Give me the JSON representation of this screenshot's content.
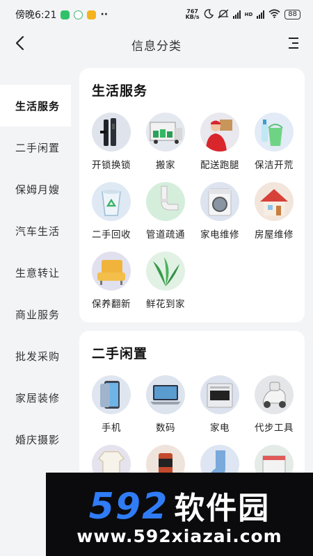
{
  "status_bar": {
    "time": "傍晚6:21",
    "dots": "··",
    "net_speed_value": "767",
    "net_speed_unit": "KB/s",
    "hd": "HD",
    "battery": "88"
  },
  "header": {
    "title": "信息分类",
    "back_icon": "chevron-left-icon",
    "menu_icon": "list-menu-icon"
  },
  "sidebar": {
    "items": [
      {
        "label": "生活服务",
        "active": true
      },
      {
        "label": "二手闲置",
        "active": false
      },
      {
        "label": "保姆月嫂",
        "active": false
      },
      {
        "label": "汽车生活",
        "active": false
      },
      {
        "label": "生意转让",
        "active": false
      },
      {
        "label": "商业服务",
        "active": false
      },
      {
        "label": "批发采购",
        "active": false
      },
      {
        "label": "家居装修",
        "active": false
      },
      {
        "label": "婚庆摄影",
        "active": false
      }
    ]
  },
  "sections": [
    {
      "title": "生活服务",
      "items": [
        {
          "label": "开锁换锁",
          "icon": "door-lock-icon"
        },
        {
          "label": "搬家",
          "icon": "moving-truck-icon"
        },
        {
          "label": "配送跑腿",
          "icon": "delivery-person-icon"
        },
        {
          "label": "保洁开荒",
          "icon": "cleaning-bucket-icon"
        },
        {
          "label": "二手回收",
          "icon": "recycle-bin-icon"
        },
        {
          "label": "管道疏通",
          "icon": "pipe-icon"
        },
        {
          "label": "家电维修",
          "icon": "washing-machine-icon"
        },
        {
          "label": "房屋维修",
          "icon": "house-icon"
        },
        {
          "label": "保养翻新",
          "icon": "sofa-icon"
        },
        {
          "label": "鲜花到家",
          "icon": "plant-icon"
        }
      ]
    },
    {
      "title": "二手闲置",
      "items": [
        {
          "label": "手机",
          "icon": "phone-icon"
        },
        {
          "label": "数码",
          "icon": "laptop-icon"
        },
        {
          "label": "家电",
          "icon": "appliance-icon"
        },
        {
          "label": "代步工具",
          "icon": "scooter-icon"
        }
      ]
    }
  ],
  "watermark": {
    "number": "592",
    "name": "软件园",
    "url": "www.592xiazai.com"
  },
  "colors": {
    "background": "#f3f4f6",
    "card": "#ffffff",
    "watermark_blue": "#2f7cf6"
  }
}
